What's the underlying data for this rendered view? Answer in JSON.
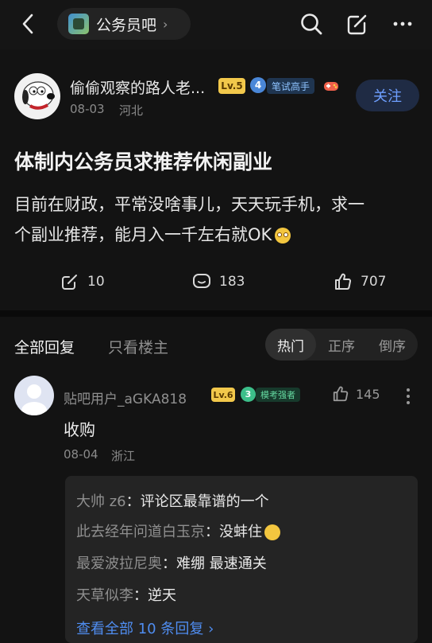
{
  "nav": {
    "forum_name": "公务员吧",
    "forum_chevron": "›"
  },
  "post": {
    "author": "偷偷观察的路人老...",
    "level": "Lv.5",
    "badge_number": "4",
    "title_tag": "笔试高手",
    "date": "08-03",
    "location": "河北",
    "follow_label": "关注",
    "title": "体制内公务员求推荐休闲副业",
    "body_line1": "目前在财政，平常没啥事儿，天天玩手机，求一",
    "body_line2": "个副业推荐，能月入一千左右就OK",
    "share_count": "10",
    "comment_count": "183",
    "like_count": "707"
  },
  "tabs": {
    "all_replies": "全部回复",
    "author_only": "只看楼主",
    "sort_hot": "热门",
    "sort_asc": "正序",
    "sort_desc": "倒序"
  },
  "reply": {
    "username": "贴吧用户_aGKA818",
    "level": "Lv.6",
    "badge_number": "3",
    "title_tag": "模考强者",
    "like_count": "145",
    "text": "收购",
    "date": "08-04",
    "location": "浙江",
    "sub_replies": [
      {
        "user": "大帅 z6",
        "text": "评论区最靠谱的一个"
      },
      {
        "user": "此去经年问道白玉京",
        "text": "没蚌住"
      },
      {
        "user": "最爱波拉尼奥",
        "text": "难绷 最速通关"
      },
      {
        "user": "天草似李",
        "text": "逆天"
      }
    ],
    "view_all": "查看全部 10 条回复 ›"
  },
  "colors": {
    "background": "#131313",
    "accent_blue": "#4f8df0",
    "level_gold": "#f2c84b"
  }
}
